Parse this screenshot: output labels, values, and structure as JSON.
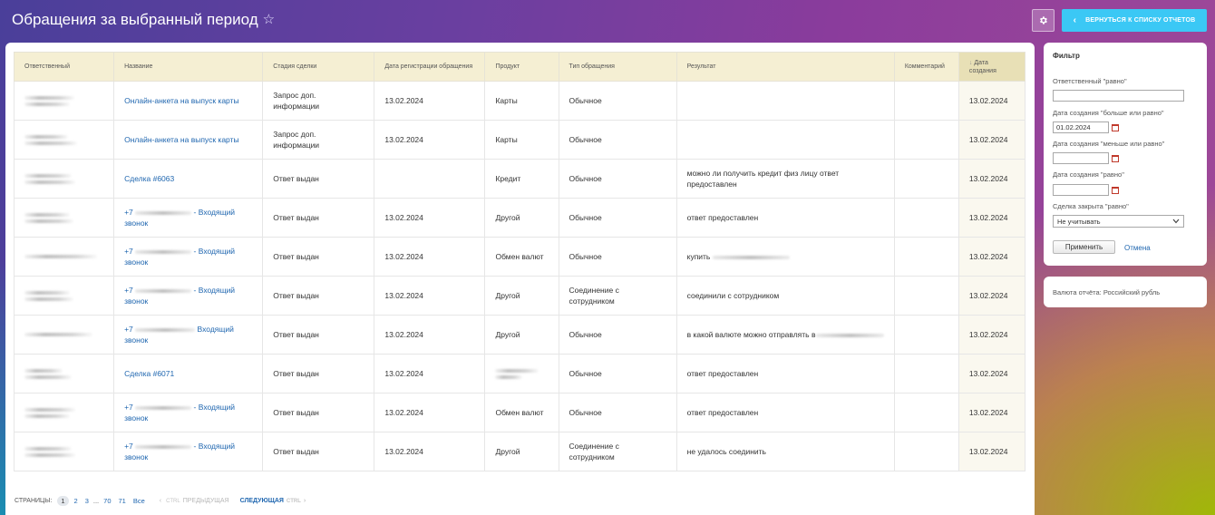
{
  "header": {
    "title": "Обращения за выбранный период",
    "back_label": "Вернуться к списку отчетов"
  },
  "table": {
    "columns": [
      "Ответственный",
      "Название",
      "Стадия сделки",
      "Дата регистрации обращения",
      "Продукт",
      "Тип обращения",
      "Результат",
      "Комментарий",
      "Дата создания"
    ],
    "rows": [
      {
        "name": "Онлайн-анкета на выпуск карты",
        "stage": "Запрос доп. информации",
        "reg_date": "13.02.2024",
        "product": "Карты",
        "type": "Обычное",
        "result": "",
        "created": "13.02.2024"
      },
      {
        "name": "Онлайн-анкета на выпуск карты",
        "stage": "Запрос доп. информации",
        "reg_date": "13.02.2024",
        "product": "Карты",
        "type": "Обычное",
        "result": "",
        "created": "13.02.2024"
      },
      {
        "name": "Сделка #6063",
        "stage": "Ответ выдан",
        "reg_date": "",
        "product": "Кредит",
        "type": "Обычное",
        "result": "можно ли получить кредит физ лицу ответ предоставлен",
        "created": "13.02.2024"
      },
      {
        "name_prefix": "+7",
        "name_suffix": "- Входящий звонок",
        "stage": "Ответ выдан",
        "reg_date": "13.02.2024",
        "product": "Другой",
        "type": "Обычное",
        "result": "ответ предоставлен",
        "created": "13.02.2024"
      },
      {
        "name_prefix": "+7",
        "name_suffix": "- Входящий звонок",
        "stage": "Ответ выдан",
        "reg_date": "13.02.2024",
        "product": "Обмен валют",
        "type": "Обычное",
        "result": "купить",
        "created": "13.02.2024"
      },
      {
        "name_prefix": "+7",
        "name_suffix": "- Входящий звонок",
        "stage": "Ответ выдан",
        "reg_date": "13.02.2024",
        "product": "Другой",
        "type": "Соединение с сотрудником",
        "result": "соединили с сотрудником",
        "created": "13.02.2024"
      },
      {
        "name_prefix": "+7",
        "name_suffix": "Входящий звонок",
        "stage": "Ответ выдан",
        "reg_date": "13.02.2024",
        "product": "Другой",
        "type": "Обычное",
        "result": "в какой валюте можно отправлять в",
        "created": "13.02.2024"
      },
      {
        "name": "Сделка #6071",
        "stage": "Ответ выдан",
        "reg_date": "13.02.2024",
        "product": "",
        "type": "Обычное",
        "result": "ответ предоставлен",
        "created": "13.02.2024"
      },
      {
        "name_prefix": "+7",
        "name_suffix": "- Входящий звонок",
        "stage": "Ответ выдан",
        "reg_date": "13.02.2024",
        "product": "Обмен валют",
        "type": "Обычное",
        "result": "ответ предоставлен",
        "created": "13.02.2024"
      },
      {
        "name_prefix": "+7",
        "name_suffix": "- Входящий звонок",
        "stage": "Ответ выдан",
        "reg_date": "13.02.2024",
        "product": "Другой",
        "type": "Соединение с сотрудником",
        "result": "не удалось соединить",
        "created": "13.02.2024"
      }
    ]
  },
  "pager": {
    "label": "Страницы:",
    "pages": [
      "1",
      "2",
      "3",
      "...",
      "70",
      "71",
      "Все"
    ],
    "ctrl": "Ctrl",
    "prev": "Предыдущая",
    "next": "Следующая"
  },
  "filter": {
    "title": "Фильтр",
    "responsible_label": "Ответственный \"равно\"",
    "created_gt_label": "Дата создания \"больше или равно\"",
    "created_gt_value": "01.02.2024",
    "created_lt_label": "Дата создания \"меньше или равно\"",
    "created_eq_label": "Дата создания \"равно\"",
    "closed_label": "Сделка закрыта \"равно\"",
    "closed_value": "Не учитывать",
    "apply": "Применить",
    "cancel": "Отмена"
  },
  "currency": {
    "text": "Валюта отчёта: Российский рубль"
  },
  "colors": {
    "accent": "#3bc8f5",
    "link": "#2067b0",
    "header_bg": "#f5efd3"
  }
}
